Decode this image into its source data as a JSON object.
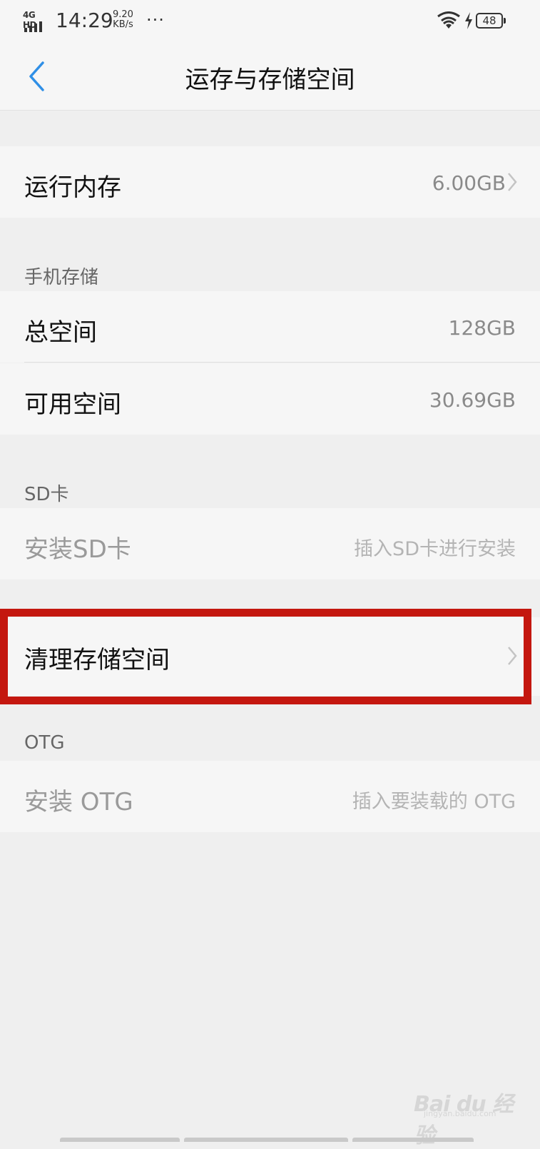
{
  "status_bar": {
    "network": "4G HD",
    "time": "14:29",
    "speed_value": "9.20",
    "speed_unit": "KB/s",
    "more": "···",
    "battery": "48"
  },
  "header": {
    "title": "运存与存储空间"
  },
  "ram": {
    "label": "运行内存",
    "value": "6.00GB"
  },
  "phone_storage": {
    "header": "手机存储",
    "total_label": "总空间",
    "total_value": "128GB",
    "available_label": "可用空间",
    "available_value": "30.69GB"
  },
  "sd_card": {
    "header": "SD卡",
    "mount_label": "安装SD卡",
    "mount_hint": "插入SD卡进行安装"
  },
  "clean": {
    "label": "清理存储空间"
  },
  "otg": {
    "header": "OTG",
    "mount_label": "安装 OTG",
    "mount_hint": "插入要装载的 OTG"
  },
  "colors": {
    "accent": "#2f8fe6",
    "highlight": "#c4170f"
  },
  "watermark": {
    "logo": "Bai du 经验",
    "url": "jingyan.baidu.com"
  }
}
